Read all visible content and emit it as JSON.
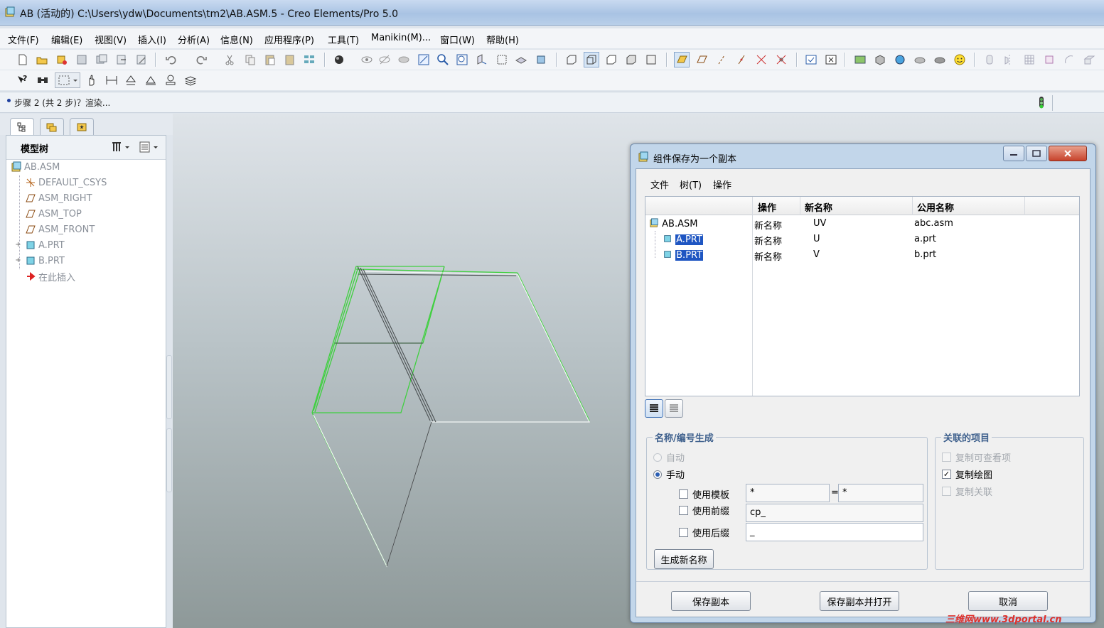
{
  "window": {
    "title": "AB (活动的) C:\\Users\\ydw\\Documents\\tm2\\AB.ASM.5 - Creo Elements/Pro 5.0"
  },
  "menu": [
    "文件(F)",
    "编辑(E)",
    "视图(V)",
    "插入(I)",
    "分析(A)",
    "信息(N)",
    "应用程序(P)",
    "工具(T)",
    "Manikin(M)...",
    "窗口(W)",
    "帮助(H)"
  ],
  "message": "步骤 2 (共 2 步)？渲染...",
  "model_tree": {
    "title": "模型树",
    "items": [
      "AB.ASM",
      "DEFAULT_CSYS",
      "ASM_RIGHT",
      "ASM_TOP",
      "ASM_FRONT",
      "A.PRT",
      "B.PRT",
      "在此插入"
    ]
  },
  "dialog": {
    "title": "组件保存为一个副本",
    "menu": [
      "文件",
      "树(T)",
      "操作"
    ],
    "columns": [
      "操作",
      "新名称",
      "公用名称"
    ],
    "rows": [
      {
        "name": "AB.ASM",
        "op": "新名称",
        "new_name": "UV",
        "common": "abc.asm"
      },
      {
        "name": "A.PRT",
        "op": "新名称",
        "new_name": "U",
        "common": "a.prt"
      },
      {
        "name": "B.PRT",
        "op": "新名称",
        "new_name": "V",
        "common": "b.prt"
      }
    ],
    "name_gen": {
      "legend": "名称/编号生成",
      "auto": "自动",
      "manual": "手动",
      "use_template": "使用模板",
      "template_from": "*",
      "equals": "=",
      "template_to": "*",
      "use_prefix": "使用前缀",
      "prefix_value": "cp_",
      "use_suffix": "使用后缀",
      "suffix_value": "_",
      "generate_button": "生成新名称"
    },
    "related": {
      "legend": "关联的项目",
      "copy_viewable": "复制可查看项",
      "copy_drawing": "复制绘图",
      "copy_relations": "复制关联"
    },
    "buttons": {
      "save_copy": "保存副本",
      "save_copy_open": "保存副本并打开",
      "cancel": "取消"
    }
  },
  "watermark": "三维网www.3dportal.cn",
  "colors": {
    "selection": "#1f56c2",
    "edge_green": "#3fd03f",
    "edge_white": "#ffffff"
  }
}
